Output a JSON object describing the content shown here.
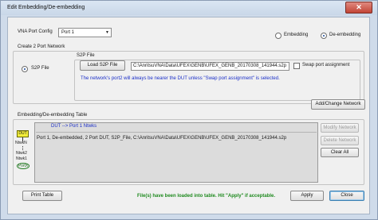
{
  "window": {
    "title": "Edit Embedding/De-embedding",
    "close_glyph": "✕"
  },
  "port_config": {
    "label": "VNA Port Config",
    "selected": "Port 1",
    "mode_options": [
      {
        "label": "Embedding",
        "selected": false
      },
      {
        "label": "De-embedding",
        "selected": true
      }
    ]
  },
  "create_network": {
    "group_label": "Create 2 Port Network",
    "type_label": "S2P File",
    "type_selected": true,
    "file_group_label": "S2P File",
    "load_button": "Load S2P File",
    "file_path": "C:\\AnritsuVNA\\Data\\UFEX\\GENB\\UFEX_GENB_20170308_141944.s2p",
    "swap_label": "Swap port assignment",
    "swap_checked": false,
    "note": "The network's port2 will always be nearer the DUT unless \"Swap port assignment\" is selected.",
    "note_color": "#1b2fc8"
  },
  "table": {
    "group_label": "Embedding/De-embedding Table",
    "add_change_button": "Add/Change Network",
    "diagram": {
      "dut": "DUT",
      "labels": [
        "NtwkN",
        "Ntwk2",
        "Ntwk1"
      ],
      "port": "PortX"
    },
    "header": "DUT --> Port 1 Ntwks",
    "rows": [
      "Port 1, De-embedded, 2 Port DUT, S2P_File, C:\\AnritsuVNA\\Data\\UFEX\\GENB\\UFEX_GENB_20170308_141944.s2p"
    ],
    "modify_button": "Modify Network",
    "delete_button": "Delete Network",
    "clear_button": "Clear All"
  },
  "footer": {
    "print_button": "Print Table",
    "status": "File(s) have been loaded into table. Hit \"Apply\" if acceptable.",
    "status_color": "#1f8a1f",
    "apply_button": "Apply",
    "close_button": "Close"
  }
}
